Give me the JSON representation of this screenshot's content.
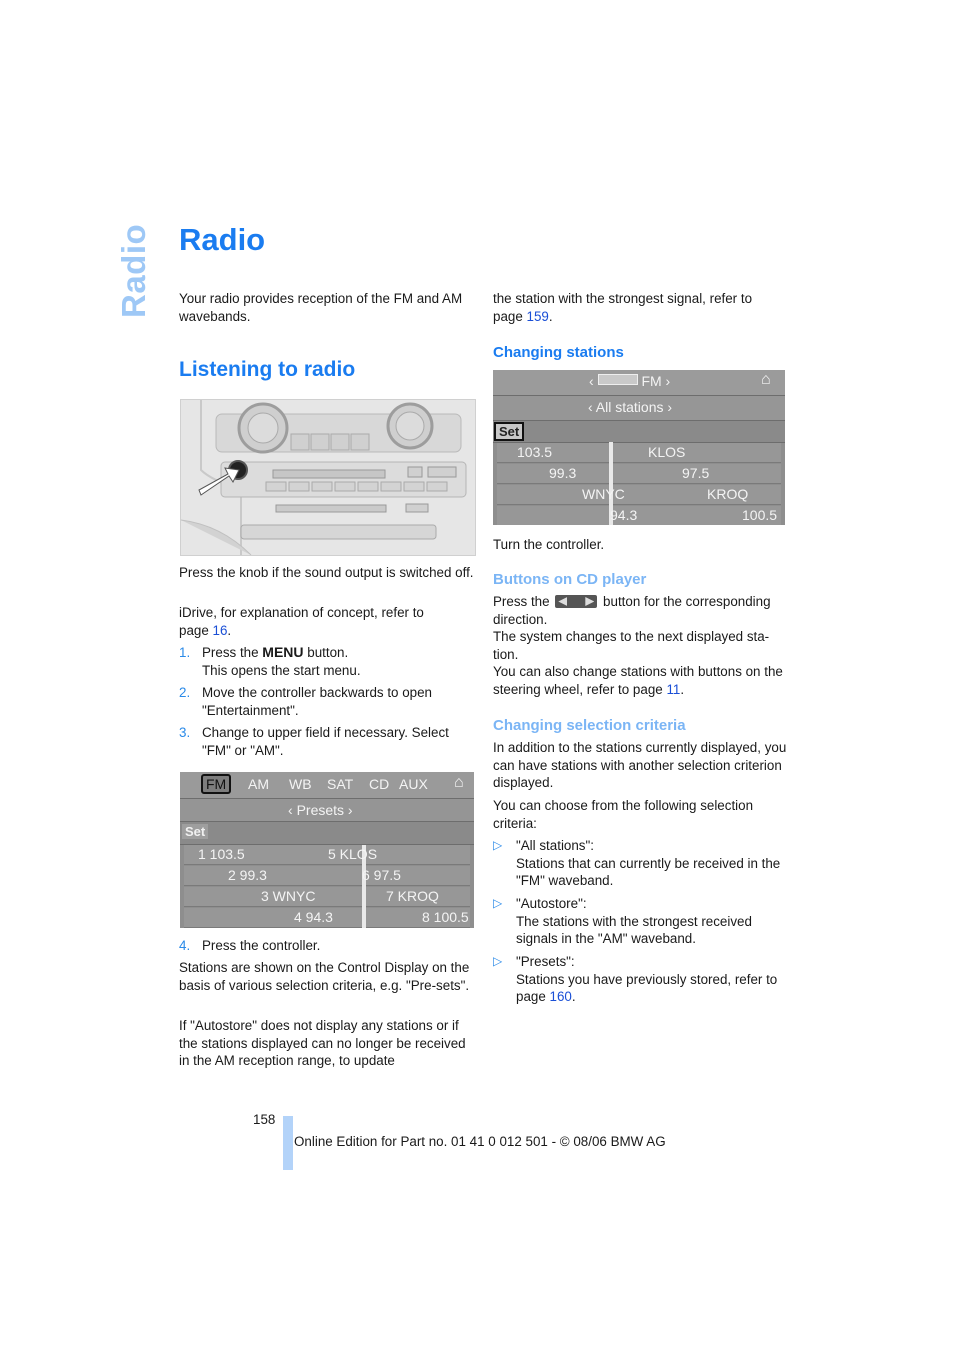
{
  "side_tab": "Radio",
  "page_title": "Radio",
  "intro": "Your radio provides reception of the FM and AM wavebands.",
  "listening": {
    "heading": "Listening to radio",
    "caption_knob": "Press the knob if the sound output is switched off.",
    "idrive_text": "iDrive, for explanation of concept, refer to",
    "idrive_page_prefix": "page ",
    "idrive_page": "16",
    "steps": [
      {
        "num": "1.",
        "before": "Press the ",
        "glyph": "MENU",
        "after": " button.",
        "line2": "This opens the start menu."
      },
      {
        "num": "2.",
        "text": "Move the controller backwards to open \"Entertainment\"."
      },
      {
        "num": "3.",
        "text": "Change to upper field if necessary. Select \"FM\" or \"AM\"."
      },
      {
        "num": "4.",
        "text": "Press the controller."
      }
    ],
    "after_steps_1": "Stations are shown on the Control Display on the basis of various selection criteria, e.g. \"Pre-sets\".",
    "after_steps_2": "If \"Autostore\" does not display any stations or if the stations displayed can no longer be received in the AM reception range, to update",
    "continued": "the station with the strongest signal, refer to",
    "continued_page_prefix": "page ",
    "continued_page": "159"
  },
  "presets_screen": {
    "tabs": [
      "FM",
      "AM",
      "WB",
      "SAT",
      "CD",
      "AUX"
    ],
    "selected_tab": "FM",
    "criterion": "Presets",
    "set_label": "Set",
    "left_col": [
      "1 103.5",
      "2 99.3",
      "3 WNYC",
      "4 94.3"
    ],
    "right_col": [
      "5 KLOS",
      "6 97.5",
      "7 KROQ",
      "8 100.5"
    ]
  },
  "changing_stations": {
    "heading": "Changing stations",
    "screen": {
      "band": "FM",
      "criterion": "All stations",
      "set_label": "Set",
      "left_col": [
        "103.5",
        "99.3",
        "WNYC",
        "94.3"
      ],
      "right_col": [
        "KLOS",
        "97.5",
        "KROQ",
        "100.5"
      ]
    },
    "caption": "Turn the controller."
  },
  "cd_buttons": {
    "heading": "Buttons on CD player",
    "text_before": "Press the",
    "text_after": "button for the corresponding direction.",
    "text2": "The system changes to the next displayed sta-tion.",
    "text3": "You can also change stations with buttons on the steering wheel, refer to page ",
    "text3_page": "11",
    "text3_end": "."
  },
  "selection_criteria": {
    "heading": "Changing selection criteria",
    "p1": "In addition to the stations currently displayed, you can have stations with another selection criterion displayed.",
    "p2": "You can choose from the following selection criteria:",
    "items": [
      {
        "title": "\"All stations\":",
        "desc": "Stations that can currently be received in the \"FM\" waveband."
      },
      {
        "title": "\"Autostore\":",
        "desc": "The stations with the strongest received signals in the \"AM\" waveband."
      },
      {
        "title": "\"Presets\":",
        "desc": "Stations you have previously stored, refer to",
        "page_prefix": "page ",
        "page": "160"
      }
    ]
  },
  "footer": {
    "page_number": "158",
    "edition": "Online Edition for Part no. 01 41 0 012 501 - © 08/06 BMW AG"
  }
}
